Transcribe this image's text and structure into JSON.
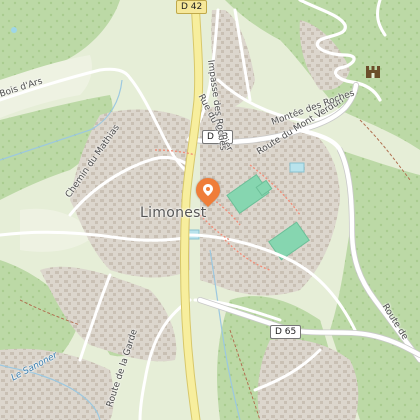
{
  "map": {
    "town": "Limonest",
    "roads": {
      "d42": "D 42",
      "d73": "D 73",
      "d65": "D 65",
      "route_mont_verdun": "Route du Mont Verdun",
      "rue_du_cuvier": "Rue du Cuvier",
      "impasse_des_roches": "Impasse des Roches",
      "montee_des_roches": "Montée des Roches",
      "chemin_du_mathias": "Chemin du Mathias",
      "bois_dars": "Bois d'Ars",
      "route_de_la_garde": "Route de la Garde",
      "route_de": "Route de"
    },
    "water": {
      "sanoner": "Le Sanoner"
    },
    "colors": {
      "forest": "#c5dfb0",
      "meadow": "#e3ecd0",
      "residential": "#dedad3",
      "major_road": "#f7ee9d",
      "road_casing": "#d8c86a",
      "marker": "#ef7d39",
      "pitch": "#86d6b0"
    },
    "icons": {
      "marker": "map-pin-icon",
      "castle": "castle-icon"
    }
  }
}
